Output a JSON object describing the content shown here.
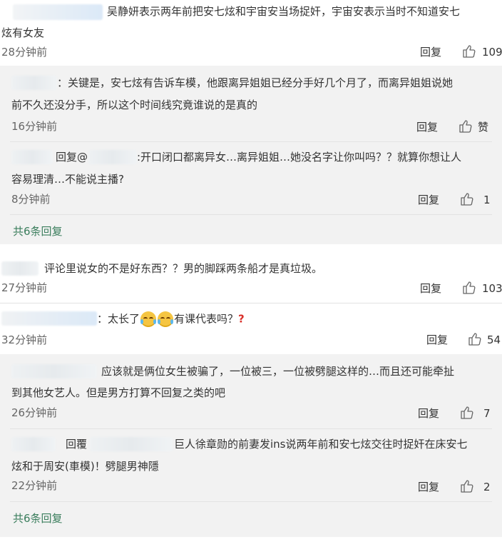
{
  "c1": {
    "line1": "吴静妍表示两年前把安七炫和宇宙安当场捉奸，宇宙安表示当时不知道安七",
    "line2": "炫有女友",
    "time": "28分钟前",
    "reply": "回复",
    "likes": "109",
    "subs": [
      {
        "line1": "：关键是，安七炫有告诉车模，他跟离异姐姐已经分手好几个月了，而离异姐姐说她",
        "line2": "前不久还没分手，所以这个时间线究竟谁说的是真的",
        "time": "16分钟前",
        "reply": "回复",
        "likes": "赞"
      },
      {
        "prefix": "回复@",
        "line1": ":开口闭口都离异女…离异姐姐…她没名字让你叫吗？？就算你想让人",
        "line2": "容易理清…不能说主播?",
        "time": "8分钟前",
        "reply": "回复",
        "likes": "1"
      }
    ],
    "more": "共6条回复"
  },
  "c2": {
    "line1": "评论里说女的不是好东西？？男的脚踩两条船才是真垃圾。",
    "time": "27分钟前",
    "reply": "回复",
    "likes": "103"
  },
  "c3": {
    "pre": "：太长了",
    "post": "有课代表吗？",
    "time": "32分钟前",
    "reply": "回复",
    "likes": "54",
    "subs": [
      {
        "line1": "应该就是俩位女生被骗了，一位被三，一位被劈腿这样的…而且还可能牵扯",
        "line2": "到其他女艺人。但是男方打算不回复之类的吧",
        "time": "26分钟前",
        "reply": "回复",
        "likes": "7"
      },
      {
        "prefix": "回覆",
        "line1": "巨人徐章勋的前妻发ins说两年前和安七炫交往时捉奸在床安七",
        "line2": "炫和于周安(車模)！劈腿男神隱",
        "time": "22分钟前",
        "reply": "回复",
        "likes": "2"
      }
    ],
    "more": "共6条回复"
  }
}
